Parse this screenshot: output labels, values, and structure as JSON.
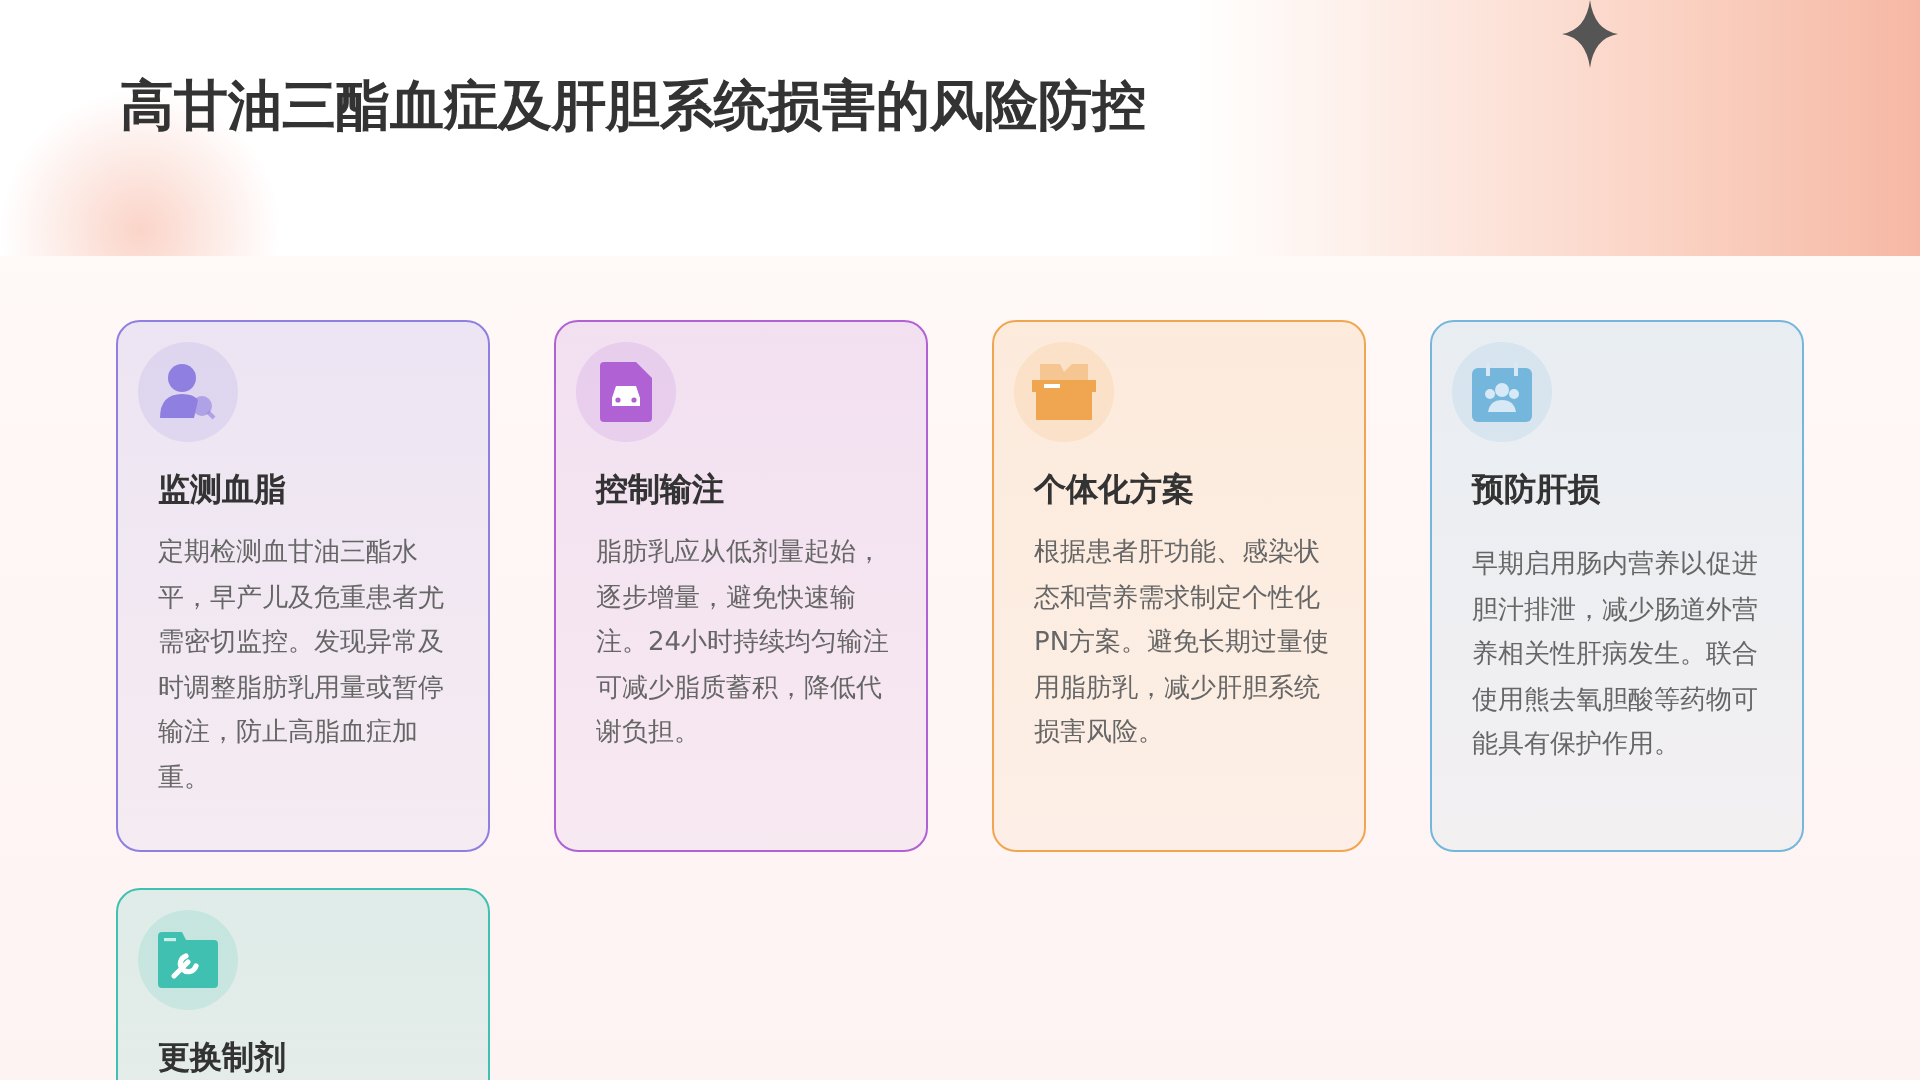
{
  "title": "高甘油三酯血症及肝胆系统损害的风险防控",
  "cards": [
    {
      "title": "监测血脂",
      "body": "定期检测血甘油三酯水平，早产儿及危重患者尤需密切监控。发现异常及时调整脂肪乳用量或暂停输注，防止高脂血症加重。",
      "color": "#8f7fe0"
    },
    {
      "title": "控制输注",
      "body": "脂肪乳应从低剂量起始，逐步增量，避免快速输注。24小时持续均匀输注可减少脂质蓄积，降低代谢负担。",
      "color": "#b062d4"
    },
    {
      "title": "个体化方案",
      "body": "根据患者肝功能、感染状态和营养需求制定个性化PN方案。避免长期过量使用脂肪乳，减少肝胆系统损害风险。",
      "color": "#f0a650"
    },
    {
      "title": "预防肝损",
      "body": "早期启用肠内营养以促进胆汁排泄，减少肠道外营养相关性肝病发生。联合使用熊去氧胆酸等药物可能具有保护作用。",
      "color": "#74b6dc"
    },
    {
      "title": "更换制剂",
      "color": "#3fc0b0"
    }
  ]
}
